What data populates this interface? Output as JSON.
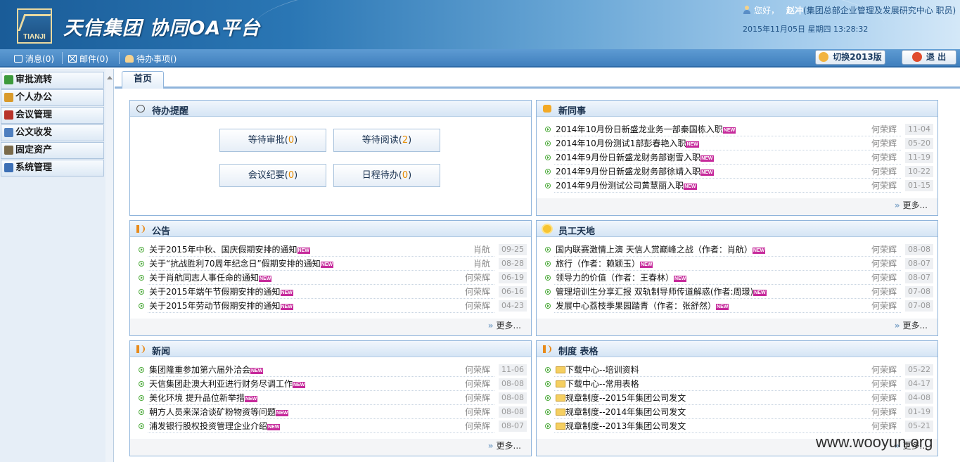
{
  "header": {
    "logo_text": "TIANJI",
    "title": "天信集团  协同OA平台",
    "greeting": "您好，",
    "user_name": "赵冲",
    "user_org": "(集团总部企业管理及发展研究中心  职员)",
    "datetime": "2015年11月05日  星期四  13:28:32"
  },
  "toolbar": {
    "msg_label": "消息(",
    "msg_count": "0",
    "msg_tail": ")",
    "mail_label": "邮件(0)",
    "todo_label": "待办事项()",
    "switch_label": "切换2013版",
    "exit_label": "退  出"
  },
  "sidebar": {
    "items": [
      {
        "label": "审批流转",
        "icon": "approval-icon",
        "color": "#3c9a3c"
      },
      {
        "label": "个人办公",
        "icon": "person-icon",
        "color": "#d99a2b"
      },
      {
        "label": "会议管理",
        "icon": "book-icon",
        "color": "#b8332a"
      },
      {
        "label": "公文收发",
        "icon": "document-icon",
        "color": "#4f7fbf"
      },
      {
        "label": "固定资产",
        "icon": "asset-icon",
        "color": "#7a6a4a"
      },
      {
        "label": "系统管理",
        "icon": "system-icon",
        "color": "#3c6fb5"
      }
    ]
  },
  "tabs": [
    {
      "label": "首页"
    }
  ],
  "panels": {
    "todo": {
      "title": "待办提醒",
      "buttons": [
        {
          "label": "等待审批",
          "count": "0"
        },
        {
          "label": "等待阅读",
          "count": "2"
        },
        {
          "label": "会议纪要",
          "count": "0"
        },
        {
          "label": "日程待办",
          "count": "0"
        }
      ]
    },
    "colleagues": {
      "title": "新同事",
      "more": "更多...",
      "rows": [
        {
          "text": "2014年10月份日新盛龙业务一部秦国栋入职",
          "author": "何荣辉",
          "date": "11-04"
        },
        {
          "text": "2014年10月份测试1部彭春艳入职",
          "author": "何荣辉",
          "date": "05-20"
        },
        {
          "text": "2014年9月份日新盛龙财务部谢雪入职",
          "author": "何荣辉",
          "date": "11-19"
        },
        {
          "text": "2014年9月份日新盛龙财务部徐靖入职",
          "author": "何荣辉",
          "date": "10-22"
        },
        {
          "text": "2014年9月份测试公司黄慧丽入职",
          "author": "何荣辉",
          "date": "01-15"
        }
      ]
    },
    "notice": {
      "title": "公告",
      "more": "更多...",
      "rows": [
        {
          "text": "关于2015年中秋、国庆假期安排的通知",
          "author": "肖航",
          "date": "09-25"
        },
        {
          "text": "关于“抗战胜利70周年纪念日”假期安排的通知",
          "author": "肖航",
          "date": "08-28"
        },
        {
          "text": "关于肖航同志人事任命的通知",
          "author": "何荣辉",
          "date": "06-19"
        },
        {
          "text": "关于2015年端午节假期安排的通知",
          "author": "何荣辉",
          "date": "06-16"
        },
        {
          "text": "关于2015年劳动节假期安排的通知",
          "author": "何荣辉",
          "date": "04-23"
        }
      ]
    },
    "staff": {
      "title": "员工天地",
      "more": "更多...",
      "rows": [
        {
          "text": "国内联赛激情上演 天信人赏巅峰之战（作者：肖航）",
          "author": "何荣辉",
          "date": "08-08"
        },
        {
          "text": "旅行（作者：赖颖玉）",
          "author": "何荣辉",
          "date": "08-07"
        },
        {
          "text": "领导力的价值（作者：王春林）",
          "author": "何荣辉",
          "date": "08-07"
        },
        {
          "text": "管理培训生分享汇报 双轨制导师传道解惑(作者:周璟)",
          "author": "何荣辉",
          "date": "07-08"
        },
        {
          "text": "发展中心荔枝季果园踏青（作者：张舒然）",
          "author": "何荣辉",
          "date": "07-08"
        }
      ]
    },
    "news": {
      "title": "新闻",
      "more": "更多...",
      "rows": [
        {
          "text": "集团隆重参加第六届外洽会",
          "author": "何荣辉",
          "date": "11-06"
        },
        {
          "text": "天信集团赴澳大利亚进行财务尽调工作",
          "author": "何荣辉",
          "date": "08-08"
        },
        {
          "text": "美化环境 提升品位新举措",
          "author": "何荣辉",
          "date": "08-08"
        },
        {
          "text": "朝方人员来深洽谈矿粉物资等问题",
          "author": "何荣辉",
          "date": "08-08"
        },
        {
          "text": "浦发银行股权投资管理企业介绍",
          "author": "何荣辉",
          "date": "08-07"
        }
      ]
    },
    "rules": {
      "title": "制度  表格",
      "more": "更多...",
      "rows": [
        {
          "text": "下载中心--培训资料",
          "author": "何荣辉",
          "date": "05-22"
        },
        {
          "text": "下载中心--常用表格",
          "author": "何荣辉",
          "date": "04-17"
        },
        {
          "text": "规章制度--2015年集团公司发文",
          "author": "何荣辉",
          "date": "04-08"
        },
        {
          "text": "规章制度--2014年集团公司发文",
          "author": "何荣辉",
          "date": "01-19"
        },
        {
          "text": "规章制度--2013年集团公司发文",
          "author": "何荣辉",
          "date": "05-21"
        }
      ]
    }
  },
  "new_badge": "NEW",
  "watermark": "www.wooyun.org",
  "colors": {
    "accent": "#2a76b4",
    "panel_border": "#8fb4db",
    "count": "#e58a00",
    "new_badge": "#c62a9b"
  }
}
